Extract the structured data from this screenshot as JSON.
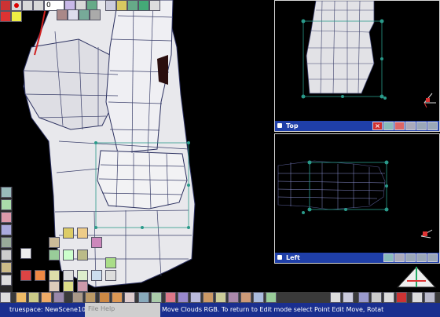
{
  "app": {
    "top_toolbar": {
      "frame_value": "0",
      "icons": [
        "stop-icon",
        "record-icon",
        "rewind-icon",
        "first-frame-icon",
        "frame-field",
        "keyframe-icon",
        "last-frame-icon",
        "motion-icon",
        "motion-alt-icon",
        "list-icon",
        "sphere-icon",
        "light-icon",
        "render-icon"
      ]
    },
    "viewports": {
      "top": {
        "label": "Top"
      },
      "left": {
        "label": "Left"
      }
    },
    "status": {
      "scene_name": "truespace: NewScene10",
      "message": "Move Clouds RGB. To return to Edit mode select Point Edit Move, Rotat",
      "menu_file": "File",
      "menu_help": "Help"
    },
    "colors": {
      "viewport_bg": "#000000",
      "titlebar": "#1f3fa8",
      "mesh_fill": "#e6e6ea",
      "mesh_line": "#3a3f6a",
      "handle": "#2a9a8a"
    }
  }
}
